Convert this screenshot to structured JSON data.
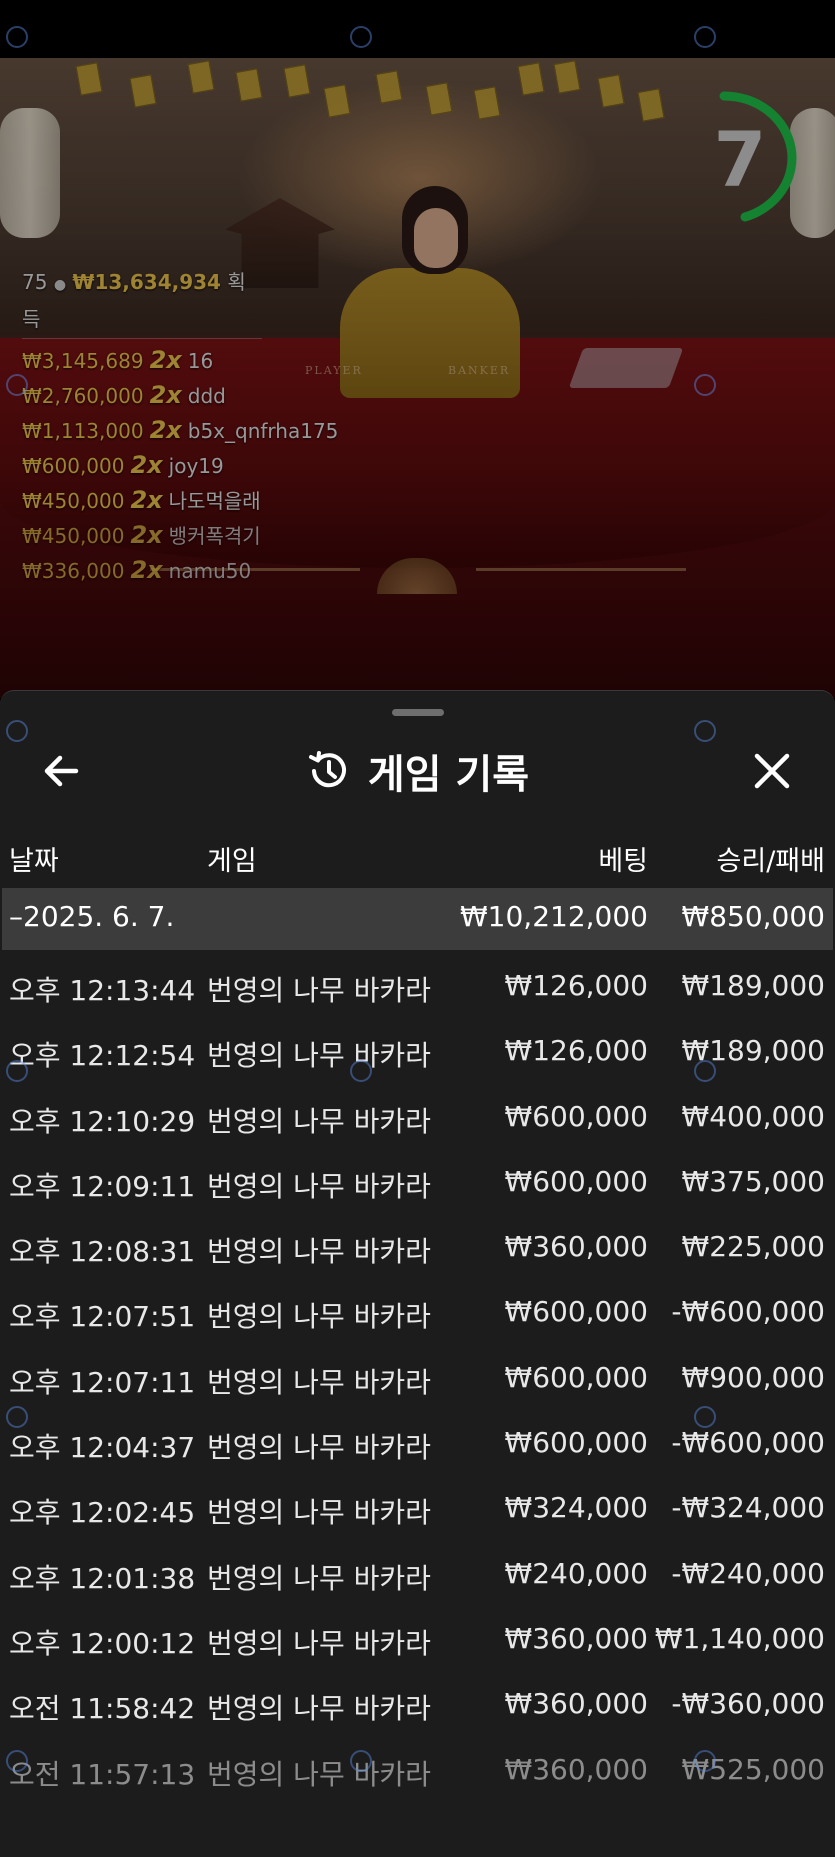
{
  "timer": {
    "value": "7",
    "fraction_remaining": 0.45
  },
  "winners_panel": {
    "player_count": "75",
    "total_amount": "₩13,634,934",
    "total_suffix": "획득",
    "entries": [
      {
        "amount": "₩3,145,689",
        "multiplier": "2x",
        "name": "16"
      },
      {
        "amount": "₩2,760,000",
        "multiplier": "2x",
        "name": "ddd"
      },
      {
        "amount": "₩1,113,000",
        "multiplier": "2x",
        "name": "b5x_qnfrha175"
      },
      {
        "amount": "₩600,000",
        "multiplier": "2x",
        "name": "joy19"
      },
      {
        "amount": "₩450,000",
        "multiplier": "2x",
        "name": "나도먹을래"
      },
      {
        "amount": "₩450,000",
        "multiplier": "2x",
        "name": "뱅커폭격기"
      },
      {
        "amount": "₩336,000",
        "multiplier": "2x",
        "name": "namu50"
      }
    ]
  },
  "table_labels": {
    "player": "PLAYER",
    "banker": "BANKER"
  },
  "sheet": {
    "title": "게임 기록",
    "columns": {
      "date": "날짜",
      "game": "게임",
      "bet": "베팅",
      "result": "승리/패배"
    },
    "date_group": {
      "date": "–2025. 6. 7.",
      "bet_total": "₩10,212,000",
      "result_total": "₩850,000"
    },
    "rows": [
      {
        "time": "오후 12:13:44",
        "game": "번영의 나무 바카라",
        "bet": "₩126,000",
        "result": "₩189,000"
      },
      {
        "time": "오후 12:12:54",
        "game": "번영의 나무 바카라",
        "bet": "₩126,000",
        "result": "₩189,000"
      },
      {
        "time": "오후 12:10:29",
        "game": "번영의 나무 바카라",
        "bet": "₩600,000",
        "result": "₩400,000"
      },
      {
        "time": "오후 12:09:11",
        "game": "번영의 나무 바카라",
        "bet": "₩600,000",
        "result": "₩375,000"
      },
      {
        "time": "오후 12:08:31",
        "game": "번영의 나무 바카라",
        "bet": "₩360,000",
        "result": "₩225,000"
      },
      {
        "time": "오후 12:07:51",
        "game": "번영의 나무 바카라",
        "bet": "₩600,000",
        "result": "-₩600,000"
      },
      {
        "time": "오후 12:07:11",
        "game": "번영의 나무 바카라",
        "bet": "₩600,000",
        "result": "₩900,000"
      },
      {
        "time": "오후 12:04:37",
        "game": "번영의 나무 바카라",
        "bet": "₩600,000",
        "result": "-₩600,000"
      },
      {
        "time": "오후 12:02:45",
        "game": "번영의 나무 바카라",
        "bet": "₩324,000",
        "result": "-₩324,000"
      },
      {
        "time": "오후 12:01:38",
        "game": "번영의 나무 바카라",
        "bet": "₩240,000",
        "result": "-₩240,000"
      },
      {
        "time": "오후 12:00:12",
        "game": "번영의 나무 바카라",
        "bet": "₩360,000",
        "result": "₩1,140,000"
      },
      {
        "time": "오전 11:58:42",
        "game": "번영의 나무 바카라",
        "bet": "₩360,000",
        "result": "-₩360,000"
      },
      {
        "time": "오전 11:57:13",
        "game": "번영의 나무 바카라",
        "bet": "₩360,000",
        "result": "₩525,000"
      }
    ]
  },
  "colors": {
    "gold": "#e8c14a",
    "timer_green": "#1fc04a",
    "sheet_bg": "#1c1c1c",
    "date_row_bg": "#3c3c3c"
  },
  "icons": {
    "back": "arrow-left-icon",
    "history": "history-clock-icon",
    "close": "close-icon"
  }
}
